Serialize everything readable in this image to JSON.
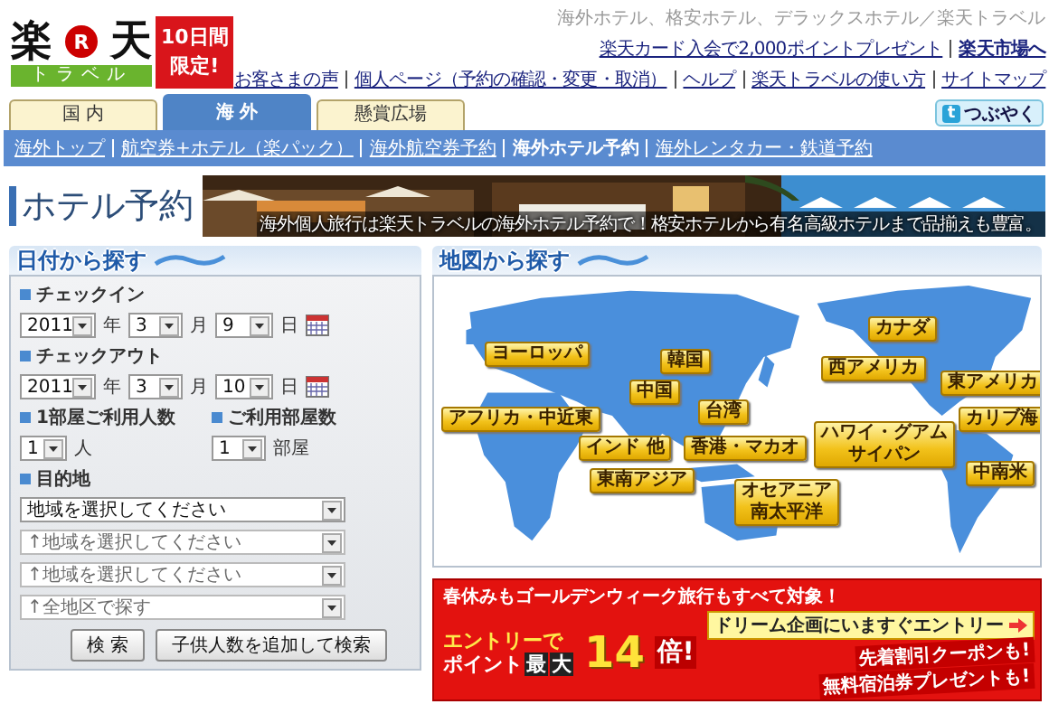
{
  "logo": {
    "mark_left": "楽",
    "mark_center": "R",
    "mark_right": "天",
    "subtitle": "トラベル",
    "badge_lines": [
      "10日間",
      "限定!"
    ]
  },
  "tagline": "海外ホテル、格安ホテル、デラックスホテル／楽天トラベル",
  "top_links": [
    {
      "label": "楽天カード入会で2,000ポイントプレゼント",
      "bold": false
    },
    {
      "label": "楽天市場へ",
      "bold": true
    }
  ],
  "nav_links": [
    "お客さまの声",
    "個人ページ（予約の確認・変更・取消）",
    "ヘルプ",
    "楽天トラベルの使い方",
    "サイトマップ"
  ],
  "tabs": [
    {
      "label": "国 内",
      "selected": false
    },
    {
      "label": "海 外",
      "selected": true
    },
    {
      "label": "懸賞広場",
      "selected": false
    }
  ],
  "tweet_button": {
    "icon_letter": "t",
    "label": "つぶやく"
  },
  "subnav": [
    {
      "label": "海外トップ",
      "current": false
    },
    {
      "label": "航空券+ホテル（楽パック）",
      "current": false
    },
    {
      "label": "海外航空券予約",
      "current": false
    },
    {
      "label": "海外ホテル予約",
      "current": true
    },
    {
      "label": "海外レンタカー・鉄道予約",
      "current": false
    }
  ],
  "page_title": "ホテル予約",
  "banner": {
    "kind": "picture",
    "caption": "海外個人旅行は楽天トラベルの海外ホテル予約で！格安ホテルから有名高級ホテルまで品揃えも豊富。"
  },
  "date_search": {
    "title": "日付から探す",
    "checkin": {
      "label": "チェックイン",
      "year": "2011",
      "year_unit": "年",
      "month": "3",
      "month_unit": "月",
      "day": "9",
      "day_unit": "日"
    },
    "checkout": {
      "label": "チェックアウト",
      "year": "2011",
      "year_unit": "年",
      "month": "3",
      "month_unit": "月",
      "day": "10",
      "day_unit": "日"
    },
    "guests": {
      "label": "1部屋ご利用人数",
      "value": "1",
      "unit": "人"
    },
    "rooms": {
      "label": "ご利用部屋数",
      "value": "1",
      "unit": "部屋"
    },
    "destination": {
      "label": "目的地",
      "selects": [
        {
          "value": "地域を選択してください",
          "disabled": false
        },
        {
          "value": "↑地域を選択してください",
          "disabled": true
        },
        {
          "value": "↑地域を選択してください",
          "disabled": true
        },
        {
          "value": "↑全地区で探す",
          "disabled": true
        }
      ]
    },
    "buttons": [
      "検 索",
      "子供人数を追加して検索"
    ]
  },
  "map_search": {
    "title": "地図から探す",
    "regions": [
      {
        "lines": [
          "ヨーロッパ"
        ]
      },
      {
        "lines": [
          "韓国"
        ]
      },
      {
        "lines": [
          "中国"
        ]
      },
      {
        "lines": [
          "カナダ"
        ]
      },
      {
        "lines": [
          "西アメリカ"
        ]
      },
      {
        "lines": [
          "東アメリカ"
        ]
      },
      {
        "lines": [
          "アフリカ・中近東"
        ]
      },
      {
        "lines": [
          "インド 他"
        ]
      },
      {
        "lines": [
          "台湾"
        ]
      },
      {
        "lines": [
          "香港・マカオ"
        ]
      },
      {
        "lines": [
          "カリブ海"
        ]
      },
      {
        "lines": [
          "ハワイ・グアム",
          "サイパン"
        ]
      },
      {
        "lines": [
          "東南アジア"
        ]
      },
      {
        "lines": [
          "オセアニア",
          "南太平洋"
        ]
      },
      {
        "lines": [
          "中南米"
        ]
      }
    ]
  },
  "promo": {
    "headline": "春休みもゴールデンウィーク旅行もすべて対象！",
    "entry_button": "ドリーム企画にいますぐエントリー",
    "line1": "エントリーで",
    "line2": "ポイント",
    "max": [
      "最",
      "大"
    ],
    "multiplier": "14",
    "multiplier_unit": "倍!",
    "perks": [
      "先着割引クーポンも!",
      "無料宿泊券プレゼントも!"
    ]
  }
}
